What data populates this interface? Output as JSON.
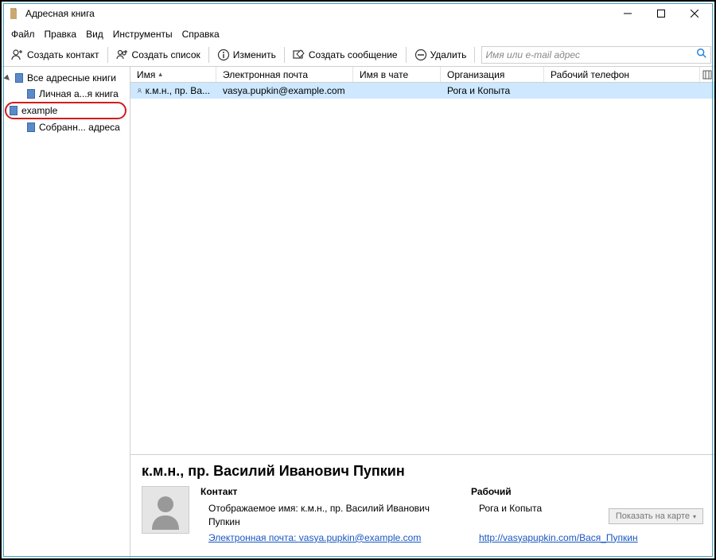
{
  "window": {
    "title": "Адресная книга"
  },
  "menu": {
    "file": "Файл",
    "edit": "Правка",
    "view": "Вид",
    "tools": "Инструменты",
    "help": "Справка"
  },
  "toolbar": {
    "new_contact": "Создать контакт",
    "new_list": "Создать список",
    "edit": "Изменить",
    "compose": "Создать сообщение",
    "delete": "Удалить",
    "search_placeholder": "Имя или e-mail адрес"
  },
  "sidebar": {
    "root": "Все адресные книги",
    "items": [
      {
        "label": "Личная а...я книга"
      },
      {
        "label": "example"
      },
      {
        "label": "Собранн... адреса"
      }
    ]
  },
  "columns": {
    "name": "Имя",
    "email": "Электронная почта",
    "chat": "Имя в чате",
    "org": "Организация",
    "phone": "Рабочий телефон"
  },
  "contacts": [
    {
      "name": "к.м.н., пр. Ва...",
      "email": "vasya.pupkin@example.com",
      "chat": "",
      "org": "Рога и Копыта",
      "phone": ""
    }
  ],
  "details": {
    "heading": "к.м.н., пр. Василий Иванович Пупкин",
    "contact_section": "Контакт",
    "display_name_line": "Отображаемое имя: к.м.н., пр. Василий Иванович Пупкин",
    "email_label": "Электронная почта: ",
    "email_value": "vasya.pupkin@example.com",
    "work_section": "Рабочий",
    "org": "Рога и Копыта",
    "url": "http://vasyapupkin.com/Вася_Пупкин",
    "map_btn": "Показать на карте"
  }
}
